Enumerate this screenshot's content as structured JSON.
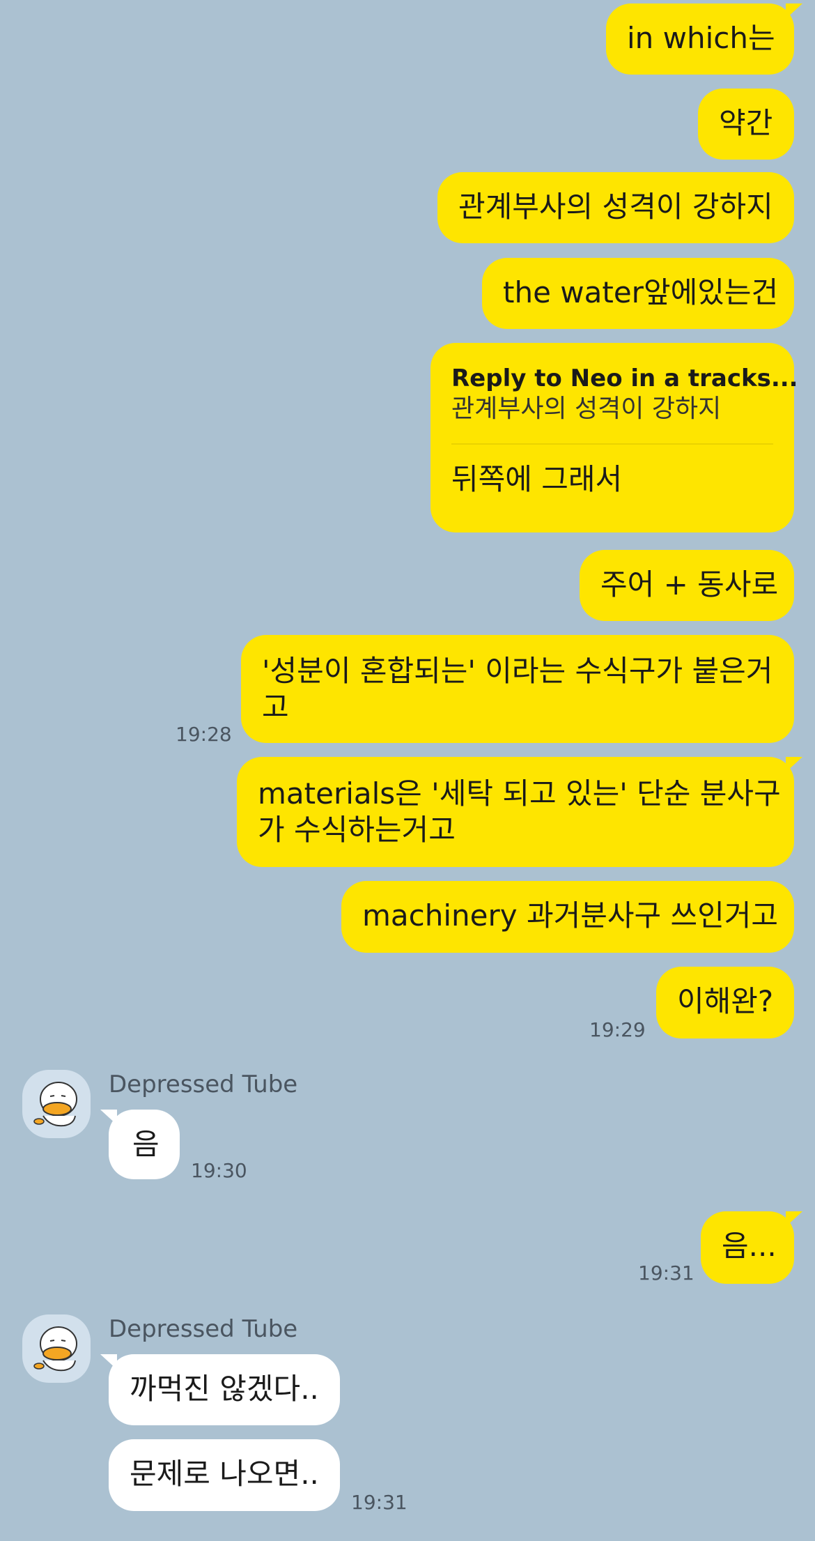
{
  "outgoing": [
    {
      "text": "in which는"
    },
    {
      "text": "약간"
    },
    {
      "text": "관계부사의 성격이 강하지"
    },
    {
      "text": "the water앞에있는건"
    },
    {
      "reply_to": "Reply to Neo in a tracks...",
      "quoted": "관계부사의 성격이 강하지",
      "text": "뒤쪽에 그래서"
    },
    {
      "text": "주어 + 동사로"
    },
    {
      "line1": "'성분이 혼합되는' 이라는 수식구가 붙은거",
      "line2": "고",
      "time": "19:28"
    },
    {
      "line1": "materials은 '세탁 되고 있는' 단순 분사구",
      "line2": "가 수식하는거고"
    },
    {
      "text": "machinery 과거분사구 쓰인거고"
    },
    {
      "text": "이해완?",
      "time": "19:29"
    },
    {
      "text": "음...",
      "time": "19:31"
    }
  ],
  "incoming_groups": [
    {
      "sender": "Depressed Tube",
      "messages": [
        {
          "text": "음",
          "time": "19:30"
        }
      ]
    },
    {
      "sender": "Depressed Tube",
      "messages": [
        {
          "text": "까먹진 않겠다.."
        },
        {
          "text": "문제로 나오면..",
          "time": "19:31"
        }
      ]
    }
  ],
  "colors": {
    "background": "#abc1d1",
    "outgoing_bubble": "#fee500",
    "incoming_bubble": "#ffffff"
  }
}
